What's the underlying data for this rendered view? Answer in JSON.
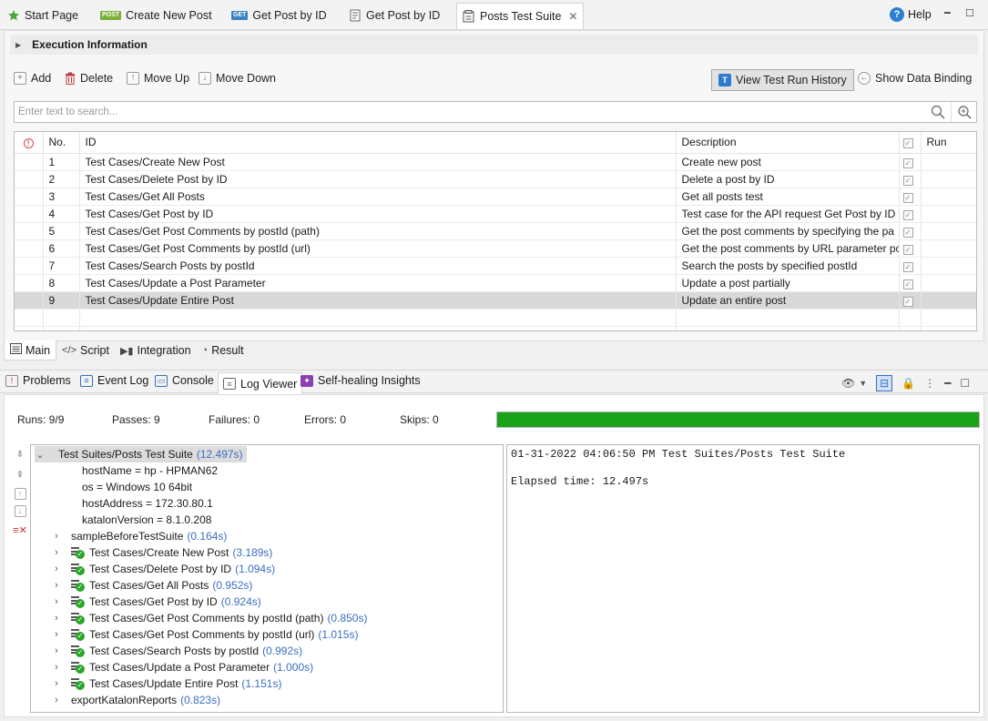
{
  "tabs": [
    {
      "label": "Start Page",
      "icon": "star-icon"
    },
    {
      "label": "Create New Post",
      "icon": "post-request-icon",
      "badge": "POST"
    },
    {
      "label": "Get Post by ID",
      "icon": "get-request-icon",
      "badge": "GET"
    },
    {
      "label": "Get Post by ID",
      "icon": "test-case-icon"
    },
    {
      "label": "Posts Test Suite",
      "icon": "test-suite-icon",
      "active": true
    }
  ],
  "help_label": "Help",
  "execution_info_label": "Execution Information",
  "toolbar": {
    "add": "Add",
    "delete": "Delete",
    "move_up": "Move Up",
    "move_down": "Move Down",
    "view_history": "View Test Run History",
    "show_binding": "Show Data Binding"
  },
  "search": {
    "placeholder": "Enter text to search...",
    "value": ""
  },
  "table": {
    "headers": {
      "no": "No.",
      "id": "ID",
      "description": "Description",
      "run": "Run"
    },
    "rows": [
      {
        "no": "1",
        "id": "Test Cases/Create New Post",
        "description": "Create new post",
        "run": true
      },
      {
        "no": "2",
        "id": "Test Cases/Delete Post by ID",
        "description": "Delete a post by ID",
        "run": true
      },
      {
        "no": "3",
        "id": "Test Cases/Get All Posts",
        "description": "Get all posts test",
        "run": true
      },
      {
        "no": "4",
        "id": "Test Cases/Get Post by ID",
        "description": "Test case for the API request Get Post by ID",
        "run": true
      },
      {
        "no": "5",
        "id": "Test Cases/Get Post Comments by postId (path)",
        "description": "Get the post comments by specifying the pa",
        "run": true
      },
      {
        "no": "6",
        "id": "Test Cases/Get Post Comments by postId (url)",
        "description": "Get the post comments by URL parameter pc",
        "run": true
      },
      {
        "no": "7",
        "id": "Test Cases/Search Posts by postId",
        "description": "Search the posts by specified postId",
        "run": true
      },
      {
        "no": "8",
        "id": "Test Cases/Update a Post Parameter",
        "description": "Update a post partially",
        "run": true
      },
      {
        "no": "9",
        "id": "Test Cases/Update Entire Post",
        "description": "Update an entire post",
        "run": true,
        "selected": true
      }
    ]
  },
  "subtabs": {
    "main": "Main",
    "script": "Script",
    "integration": "Integration",
    "result": "Result"
  },
  "lower_tabs": {
    "problems": "Problems",
    "event_log": "Event Log",
    "console": "Console",
    "log_viewer": "Log Viewer",
    "self_healing": "Self-healing Insights"
  },
  "stats": {
    "runs": "Runs: 9/9",
    "passes": "Passes:  9",
    "failures": "Failures:  0",
    "errors": "Errors:  0",
    "skips": "Skips:  0",
    "progress": 1.0,
    "progress_color": "#1aa31a"
  },
  "tree": {
    "root": {
      "label": "Test Suites/Posts Test Suite",
      "duration": "(12.497s)"
    },
    "properties": [
      "hostName = hp - HPMAN62",
      "os = Windows 10 64bit",
      "hostAddress = 172.30.80.1",
      "katalonVersion = 8.1.0.208"
    ],
    "before": {
      "label": "sampleBeforeTestSuite",
      "duration": "(0.164s)"
    },
    "cases": [
      {
        "label": "Test Cases/Create New Post",
        "duration": "(3.189s)"
      },
      {
        "label": "Test Cases/Delete Post by ID",
        "duration": "(1.094s)"
      },
      {
        "label": "Test Cases/Get All Posts",
        "duration": "(0.952s)"
      },
      {
        "label": "Test Cases/Get Post by ID",
        "duration": "(0.924s)"
      },
      {
        "label": "Test Cases/Get Post Comments by postId (path)",
        "duration": "(0.850s)"
      },
      {
        "label": "Test Cases/Get Post Comments by postId (url)",
        "duration": "(1.015s)"
      },
      {
        "label": "Test Cases/Search Posts by postId",
        "duration": "(0.992s)"
      },
      {
        "label": "Test Cases/Update a Post Parameter",
        "duration": "(1.000s)"
      },
      {
        "label": "Test Cases/Update Entire Post",
        "duration": "(1.151s)"
      }
    ],
    "after": {
      "label": "exportKatalonReports",
      "duration": "(0.823s)"
    }
  },
  "log": {
    "line1": "01-31-2022 04:06:50 PM Test Suites/Posts Test Suite",
    "line2": "Elapsed time: 12.497s"
  }
}
